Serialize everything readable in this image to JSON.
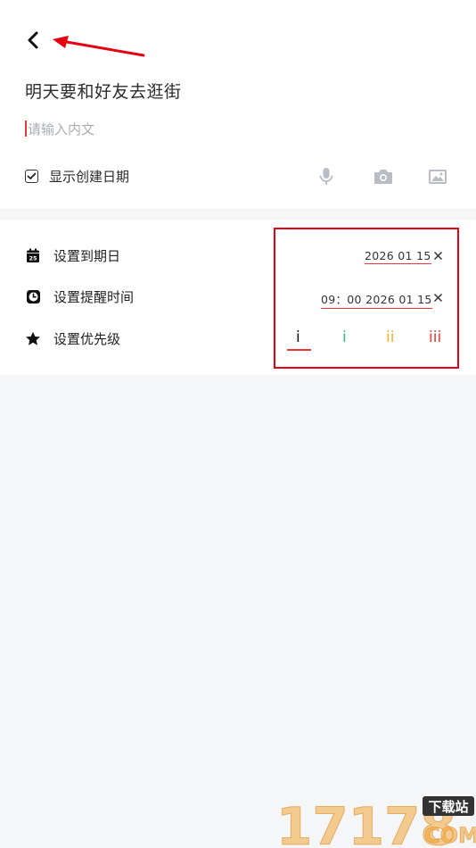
{
  "note": {
    "title": "明天要和好友去逛街",
    "body_placeholder": "请输入内文"
  },
  "options": {
    "show_created_date_label": "显示创建日期",
    "show_created_date_checked": true
  },
  "toolbar": {
    "icons": [
      "microphone-icon",
      "camera-icon",
      "image-icon"
    ]
  },
  "settings": {
    "due_date": {
      "label": "设置到期日",
      "calendar_day": "25",
      "value": "2026 01 15"
    },
    "reminder": {
      "label": "设置提醒时间",
      "value": "09：00 2026 01 15"
    },
    "priority": {
      "label": "设置优先级",
      "levels": [
        {
          "label": "i",
          "color": "#111111",
          "selected": true
        },
        {
          "label": "i",
          "color": "#2bbf8a",
          "selected": false
        },
        {
          "label": "ii",
          "color": "#f5b323",
          "selected": false
        },
        {
          "label": "iii",
          "color": "#e53935",
          "selected": false
        }
      ]
    }
  },
  "watermark": {
    "number": "17178",
    "tag": "下载站",
    "suffix": "COM"
  },
  "colors": {
    "accent_red": "#e53935",
    "annotation_red": "#e60012",
    "background": "#f5f6f8",
    "watermark_orange": "#f0a63a"
  }
}
